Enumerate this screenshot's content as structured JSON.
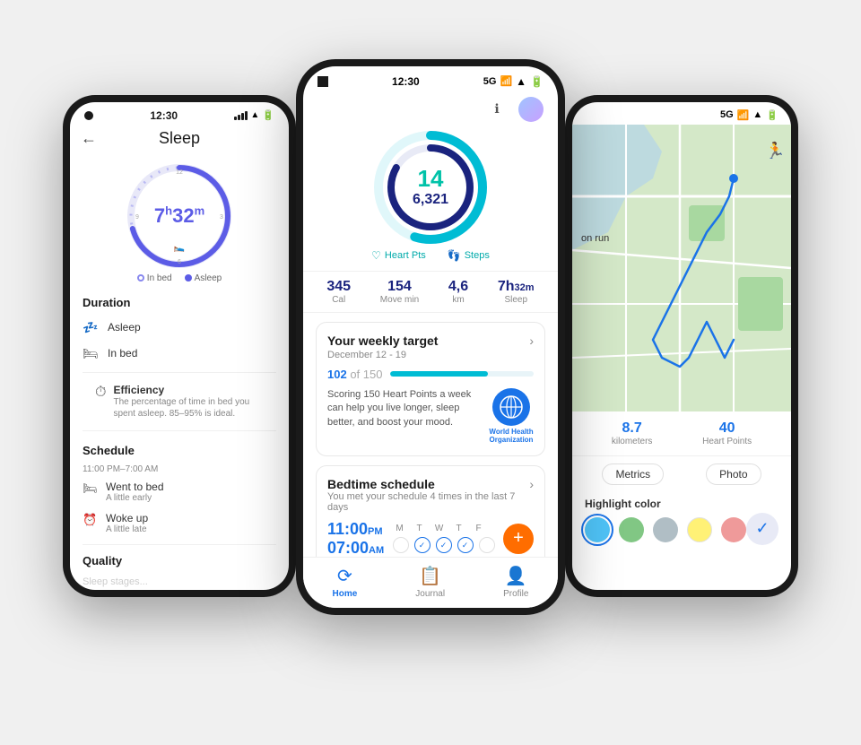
{
  "scene": {
    "bg_color": "#f0f0f0"
  },
  "left_phone": {
    "status": {
      "time": "12:30"
    },
    "title": "Sleep",
    "clock": {
      "hours": "7",
      "h_label": "h",
      "minutes": "32",
      "m_label": "m"
    },
    "legend": {
      "inbed": "In bed",
      "asleep": "Asleep"
    },
    "duration_title": "Duration",
    "rows": [
      {
        "icon": "🛌",
        "label": "Asleep"
      },
      {
        "icon": "🛏",
        "label": "In bed"
      }
    ],
    "efficiency": {
      "title": "Efficiency",
      "desc": "The percentage of time in bed you spent asleep. 85–95% is ideal."
    },
    "schedule_title": "Schedule",
    "schedule_time": "11:00 PM–7:00 AM",
    "schedule_rows": [
      {
        "icon": "🛏",
        "main": "Went to bed",
        "sub": "A little early"
      },
      {
        "icon": "⏰",
        "main": "Woke up",
        "sub": "A little late"
      }
    ],
    "quality_title": "Quality"
  },
  "center_phone": {
    "status": {
      "time": "12:30",
      "network": "5G"
    },
    "ring": {
      "main_value": "14",
      "sub_value": "6,321"
    },
    "metric_labels": [
      {
        "icon": "♡",
        "label": "Heart Pts"
      },
      {
        "icon": "👣",
        "label": "Steps"
      }
    ],
    "stats": [
      {
        "value": "345",
        "unit": "",
        "label": "Cal"
      },
      {
        "value": "154",
        "unit": "",
        "label": "Move min"
      },
      {
        "value": "4,6",
        "unit": "",
        "label": "km"
      },
      {
        "value": "7h",
        "unit": "32m",
        "label": "Sleep"
      }
    ],
    "weekly_card": {
      "title": "Your weekly target",
      "subtitle": "December 12 - 19",
      "progress_current": "102",
      "progress_total": "150",
      "progress_pct": 68,
      "description": "Scoring 150 Heart Points a week can help you live longer, sleep better, and boost your mood.",
      "who_label1": "World Health",
      "who_label2": "Organization"
    },
    "bedtime_card": {
      "title": "Bedtime schedule",
      "subtitle": "You met your schedule 4 times in the last 7 days",
      "pm_time": "11:00",
      "pm_suffix": "PM",
      "am_time": "07:00",
      "am_suffix": "AM",
      "days": [
        {
          "label": "M",
          "checked": false
        },
        {
          "label": "T",
          "checked": true
        },
        {
          "label": "W",
          "checked": true
        },
        {
          "label": "T",
          "checked": true
        },
        {
          "label": "F",
          "checked": false
        }
      ]
    },
    "nav": {
      "home_label": "Home",
      "journal_label": "Journal",
      "profile_label": "Profile"
    }
  },
  "right_phone": {
    "status": {
      "network": "5G"
    },
    "map": {
      "run_label": "on run",
      "run_icon": "🏃"
    },
    "stats": [
      {
        "value": "8.7",
        "label": "kilometers"
      },
      {
        "value": "40",
        "label": "Heart Points"
      }
    ],
    "toolbar": {
      "metrics_label": "Metrics",
      "photo_label": "Photo"
    },
    "highlight": {
      "title": "Highlight color",
      "colors": [
        "#4fc3f7",
        "#81c784",
        "#b0bec5",
        "#fff176",
        "#ef9a9a"
      ]
    }
  }
}
